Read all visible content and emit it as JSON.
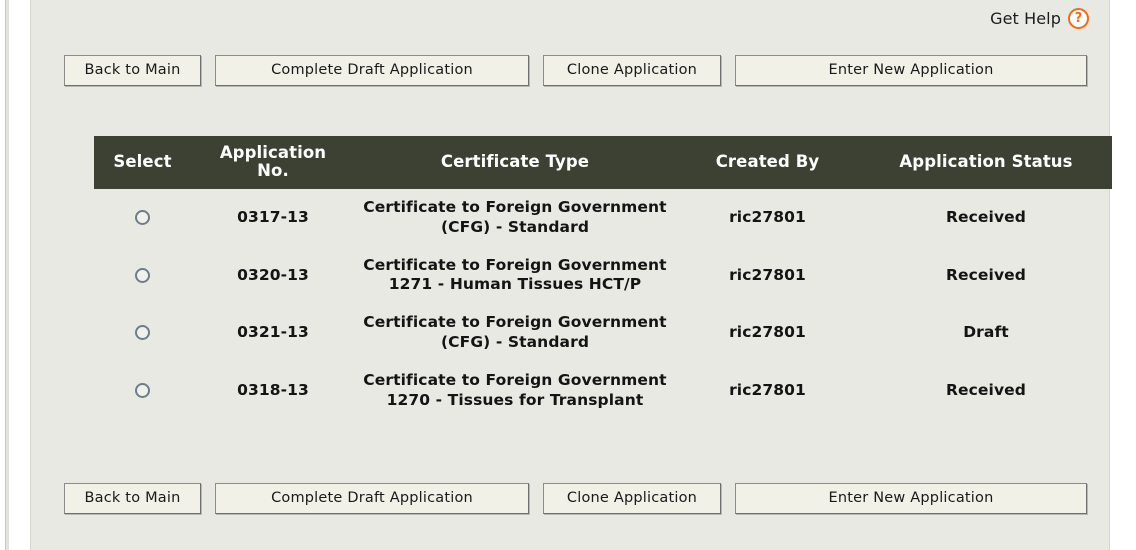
{
  "help": {
    "label": "Get Help",
    "icon": "question-mark-circle-icon",
    "glyph": "?",
    "color": "#ef6c1a"
  },
  "buttons": {
    "back_to_main": "Back to Main",
    "complete_draft_application": "Complete Draft Application",
    "clone_application": "Clone Application",
    "enter_new_application": "Enter New Application"
  },
  "table": {
    "header_background": "#3d4133",
    "columns": [
      "Select",
      "Application No.",
      "Certificate Type",
      "Created By",
      "Application Status"
    ],
    "column_lines": {
      "application_no_line1": "Application",
      "application_no_line2": "No."
    },
    "rows": [
      {
        "select": "radio-unselected",
        "application_no": "0317-13",
        "certificate_type": "Certificate to Foreign Government (CFG) - Standard",
        "created_by": "ric27801",
        "application_status": "Received"
      },
      {
        "select": "radio-unselected",
        "application_no": "0320-13",
        "certificate_type": "Certificate to Foreign Government 1271 - Human Tissues HCT/P",
        "created_by": "ric27801",
        "application_status": "Received"
      },
      {
        "select": "radio-unselected",
        "application_no": "0321-13",
        "certificate_type": "Certificate to Foreign Government (CFG) - Standard",
        "created_by": "ric27801",
        "application_status": "Draft"
      },
      {
        "select": "radio-unselected",
        "application_no": "0318-13",
        "certificate_type": "Certificate to Foreign Government 1270 - Tissues for Transplant",
        "created_by": "ric27801",
        "application_status": "Received"
      }
    ]
  }
}
